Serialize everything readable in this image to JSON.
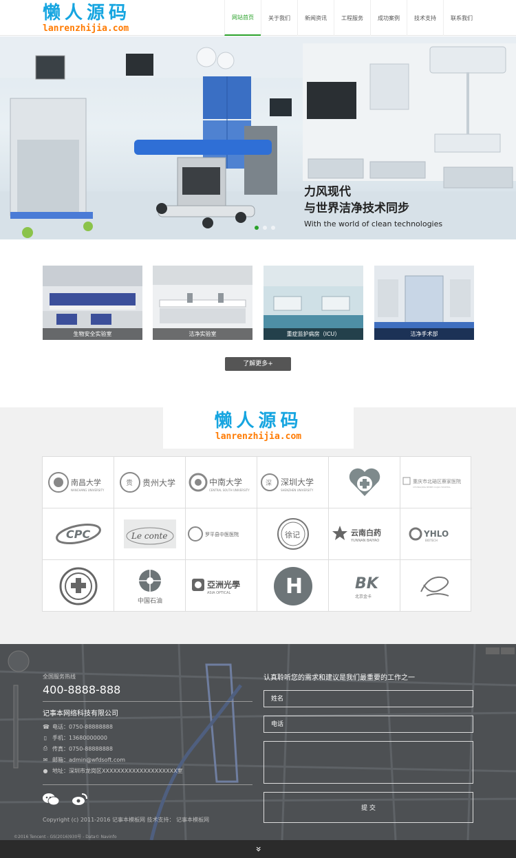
{
  "header": {
    "logo_cn": "懒人源码",
    "logo_en": "lanrenzhijia.com",
    "nav": [
      "网站首页",
      "关于我们",
      "新闻资讯",
      "工程服务",
      "成功案例",
      "技术支持",
      "联系我们"
    ],
    "active_color": "#2aa12a"
  },
  "hero": {
    "line1": "力风现代",
    "line2": "与世界洁净技术同步",
    "line3": "With the world of clean technologies"
  },
  "services": {
    "items": [
      "生物安全实验室",
      "洁净实验室",
      "重症监护病房（ICU）",
      "洁净手术部"
    ],
    "more": "了解更多+"
  },
  "partners": {
    "logo_cn": "懒人源码",
    "logo_en": "lanrenzhijia.com",
    "row1": [
      "南昌大学",
      "贵州大学",
      "中南大学",
      "深圳大学",
      "",
      "重庆市北碚区蔡家医院"
    ],
    "row1_small": [
      "NANCHANG UNIVERSITY",
      "",
      "CENTRAL SOUTH UNIVERSITY",
      "SHENZHEN UNIVERSITY",
      "",
      "CHONGQING BEIBEI CAIJIA HOSPITAL"
    ],
    "row2": [
      "CPC",
      "Le conte",
      "罗平县中医医院",
      "徐记",
      "云南白药",
      "YHLO"
    ],
    "row2_small": [
      "",
      "",
      "",
      "",
      "YUNNAN BAIYAO",
      "BIOTECH"
    ],
    "row3": [
      "",
      "中国石油",
      "亞洲光學",
      "H",
      "北京金卡",
      ""
    ],
    "row3_small": [
      "",
      "",
      "ASIA OPTICAL",
      "",
      "",
      ""
    ]
  },
  "footer": {
    "hotline_label": "全国服务热线",
    "hotline": "400-8888-888",
    "company": "记事本网络科技有限公司",
    "phone": "电话：0750-88888888",
    "mobile": "手机：13680000000",
    "fax": "传真：0750-88888888",
    "email": "邮箱：admin@wfdsoft.com",
    "address": "地址：深圳市龙岗区XXXXXXXXXXXXXXXXXXXX室",
    "form_title": "认真聆听您的需求和建议是我们最重要的工作之一",
    "name_placeholder": "姓名",
    "tel_placeholder": "电话",
    "submit": "提 交",
    "copyright": "Copyright (c) 2011-2016 记事本模板网 技术支持： 记事本模板网",
    "map_credit": "©2016 Tencent - GS(2016)930号 - Data© Navinfo"
  },
  "bottom_arrow": "»"
}
